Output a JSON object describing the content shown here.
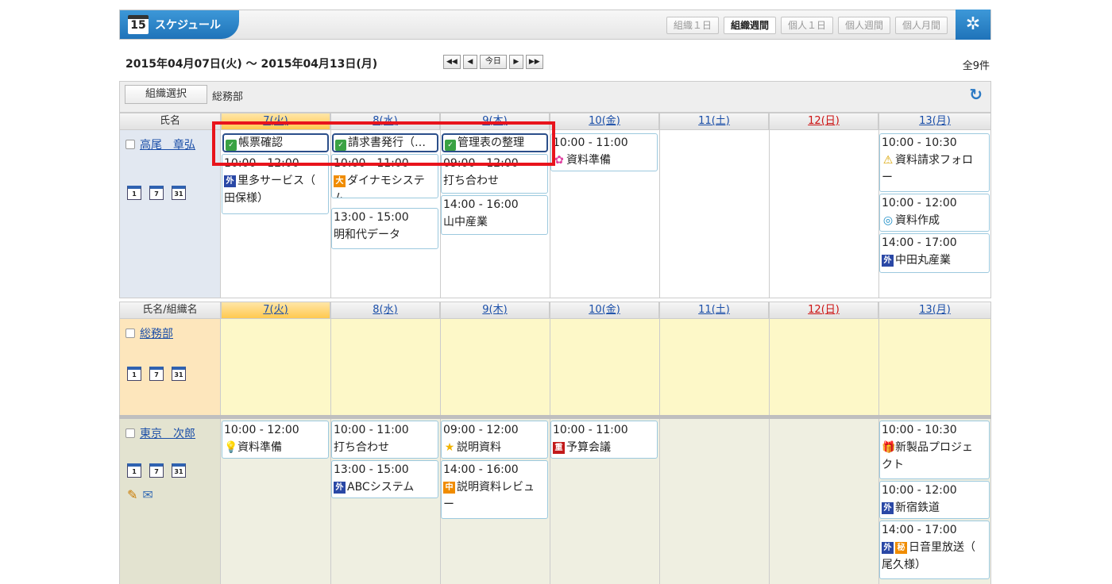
{
  "header": {
    "cal_icon_day": "15",
    "title": "スケジュール",
    "view_buttons": [
      "組織１日",
      "組織週間",
      "個人１日",
      "個人週間",
      "個人月間"
    ],
    "active_view": "組織週間",
    "settings_icon": "gear-icon"
  },
  "datebar": {
    "range": "2015年04月07日(火) ～ 2015年04月13日(月)",
    "nav": [
      "◀◀",
      "◀",
      "今日",
      "▶",
      "▶▶"
    ],
    "total": "全9件"
  },
  "orgbar": {
    "button": "組織選択",
    "org": "総務部",
    "refresh_icon": "refresh-icon"
  },
  "days": [
    "7(火)",
    "8(水)",
    "9(木)",
    "10(金)",
    "11(土)",
    "12(日)",
    "13(月)"
  ],
  "section1": {
    "name_header": "氏名",
    "person": "高尾　章弘",
    "todos": [
      "帳票確認",
      "請求書発行（…",
      "管理表の整理"
    ],
    "events": {
      "d7": [
        {
          "time": "10:00 - 12:00",
          "tag": "外",
          "text": "里多サービス（",
          "text2": "田保様）"
        }
      ],
      "d8": [
        {
          "time": "10:00 - 11:00",
          "tag": "大",
          "text": "ダイナモシステ",
          "text2": "ム"
        },
        {
          "time": "13:00 - 15:00",
          "text": "明和代データ"
        }
      ],
      "d9": [
        {
          "time": "09:00 - 12:00",
          "text": "打ち合わせ"
        },
        {
          "time": "14:00 - 16:00",
          "text": "山中産業"
        }
      ],
      "d10": [
        {
          "time": "10:00 - 11:00",
          "sym": "✿",
          "text": "資料準備"
        }
      ],
      "d13": [
        {
          "time": "10:00 - 10:30",
          "sym": "⚠",
          "text": "資料請求フォロ",
          "text2": "ー"
        },
        {
          "time": "10:00 - 12:00",
          "sym": "◎",
          "text": "資料作成"
        },
        {
          "time": "14:00 - 17:00",
          "tag": "外",
          "text": "中田丸産業"
        }
      ]
    }
  },
  "section2": {
    "name_header": "氏名/組織名",
    "org": "総務部"
  },
  "section3": {
    "person": "東京　次郎",
    "events": {
      "d7": [
        {
          "time": "10:00 - 12:00",
          "sym": "💡",
          "text": "資料準備"
        }
      ],
      "d8": [
        {
          "time": "10:00 - 11:00",
          "text": "打ち合わせ"
        },
        {
          "time": "13:00 - 15:00",
          "tag": "外",
          "text": "ABCシステム"
        }
      ],
      "d9": [
        {
          "time": "09:00 - 12:00",
          "sym": "★",
          "text": "説明資料"
        },
        {
          "time": "14:00 - 16:00",
          "tag": "中",
          "text": "説明資料レビュ",
          "text2": "ー"
        }
      ],
      "d10": [
        {
          "time": "10:00 - 11:00",
          "tag": "重",
          "text": "予算会議"
        }
      ],
      "d13": [
        {
          "time": "10:00 - 10:30",
          "sym": "🎁",
          "text": "新製品プロジェ",
          "text2": "クト"
        },
        {
          "time": "10:00 - 12:00",
          "tag": "外",
          "text": "新宿鉄道"
        },
        {
          "time": "14:00 - 17:00",
          "tag": "外",
          "tag2": "秘",
          "text": "日音里放送（",
          "text2": "尾久様）"
        }
      ]
    }
  },
  "mini_icons": [
    "1",
    "7",
    "31"
  ],
  "colors": {
    "accent": "#1f73b9",
    "today": "#ffc94f",
    "name_bg": "#e2e8f1",
    "org_bg": "#fde6bc",
    "org_cells": "#fdf8c8",
    "jiro_name_bg": "#e3e3d0",
    "jiro_cells": "#efefe1",
    "highlight": "#e8141c"
  }
}
